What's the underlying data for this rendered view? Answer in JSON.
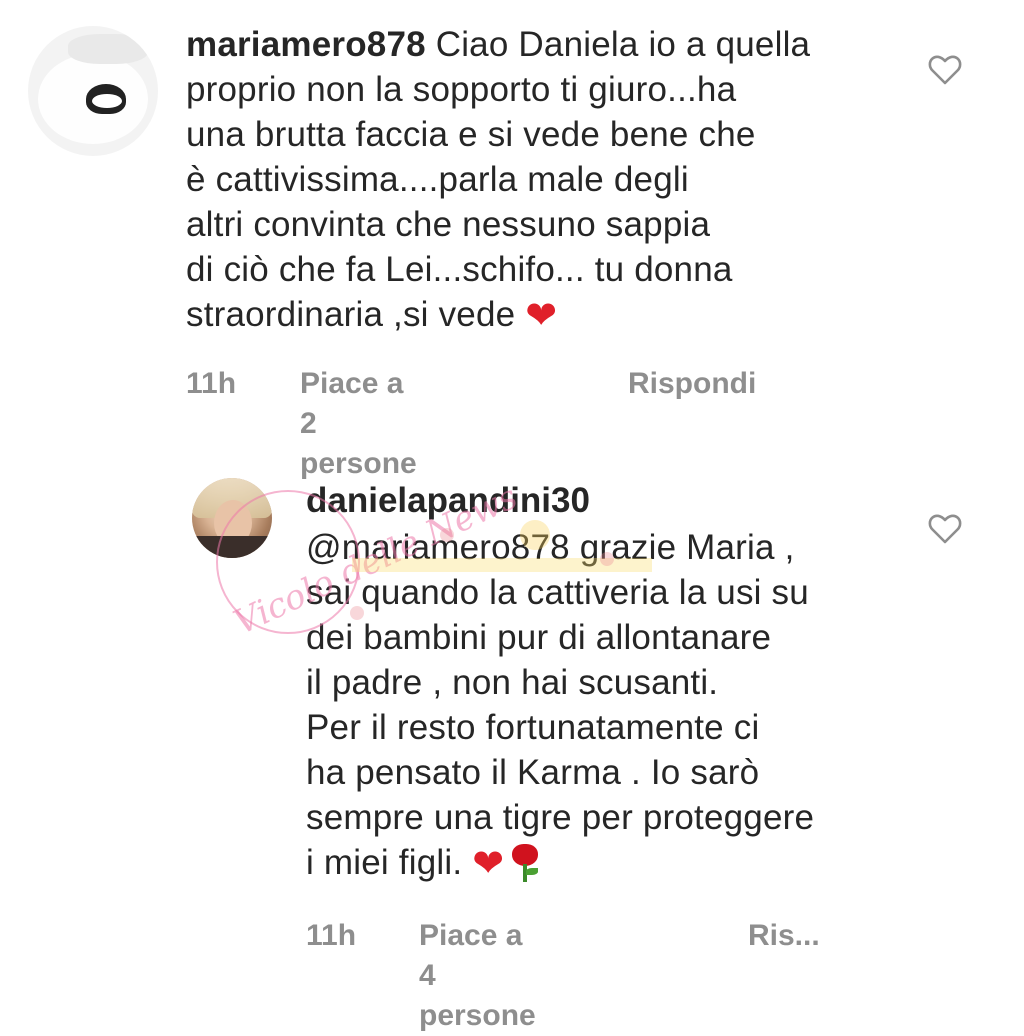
{
  "comments": [
    {
      "username": "mariamero878",
      "text": "Ciao Daniela io a quella\nproprio non la sopporto ti giuro...ha\nuna brutta faccia e si vede bene che\nè cattivissima....parla male degli\naltri convinta che nessuno sappia\ndi ciò che fa Lei...schifo... tu donna\nstraordinaria ,si vede",
      "emoji": "❤",
      "time": "11h",
      "likes": "Piace a 2 persone",
      "reply": "Rispondi"
    },
    {
      "username": "danielapandini30",
      "text": "@mariamero878 grazie Maria ,\nsai quando la cattiveria la usi su\ndei bambini pur di allontanare\nil padre , non hai scusanti.\nPer il resto fortunatamente ci\nha pensato il Karma . Io sarò\nsempre una tigre per proteggere\ni miei figli.",
      "emoji": "❤",
      "time": "11h",
      "likes": "Piace a 4 persone",
      "reply": "Ris..."
    }
  ],
  "icons": {
    "like": "heart-outline-icon",
    "rose": "rose-icon"
  },
  "watermark": {
    "text": "Vicolo delle News"
  },
  "colors": {
    "text": "#262626",
    "meta": "#8e8e8e",
    "heart": "#e0202a"
  }
}
